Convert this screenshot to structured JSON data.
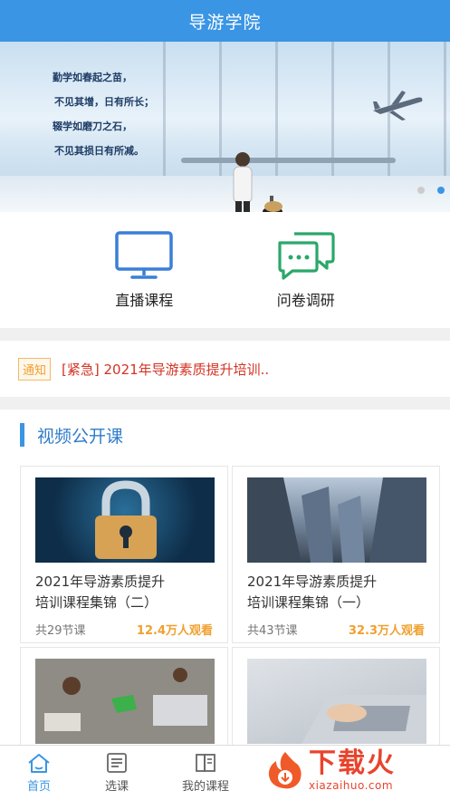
{
  "header": {
    "title": "导游学院"
  },
  "banner": {
    "quote_lines": [
      "勤学如春起之苗，",
      "不见其增，日有所长；",
      "辍学如磨刀之石，",
      "不见其损日有所减。"
    ]
  },
  "quick_actions": [
    {
      "label": "直播课程",
      "icon": "monitor-icon"
    },
    {
      "label": "问卷调研",
      "icon": "chat-bubbles-icon"
    }
  ],
  "notice": {
    "tag": "通知",
    "text": "[紧急] 2021年导游素质提升培训.."
  },
  "section": {
    "title": "视频公开课"
  },
  "courses": [
    {
      "title_line1": "2021年导游素质提升",
      "title_line2": "培训课程集锦（二）",
      "lessons": "共29节课",
      "views": "12.4万人观看"
    },
    {
      "title_line1": "2021年导游素质提升",
      "title_line2": "培训课程集锦（一）",
      "lessons": "共43节课",
      "views": "32.3万人观看"
    },
    {
      "title_line1": "",
      "title_line2": "",
      "lessons": "",
      "views": ""
    },
    {
      "title_line1": "",
      "title_line2": "",
      "lessons": "",
      "views": ""
    }
  ],
  "tabbar": [
    {
      "label": "首页",
      "icon": "home-icon"
    },
    {
      "label": "选课",
      "icon": "list-icon"
    },
    {
      "label": "我的课程",
      "icon": "book-icon"
    }
  ],
  "watermark": {
    "big": "下载火",
    "small": "xiazaihuo.com"
  },
  "colors": {
    "primary": "#3a95e4",
    "notice_red": "#d43324",
    "accent_orange": "#f0a030",
    "icon_green": "#2aa86a"
  }
}
